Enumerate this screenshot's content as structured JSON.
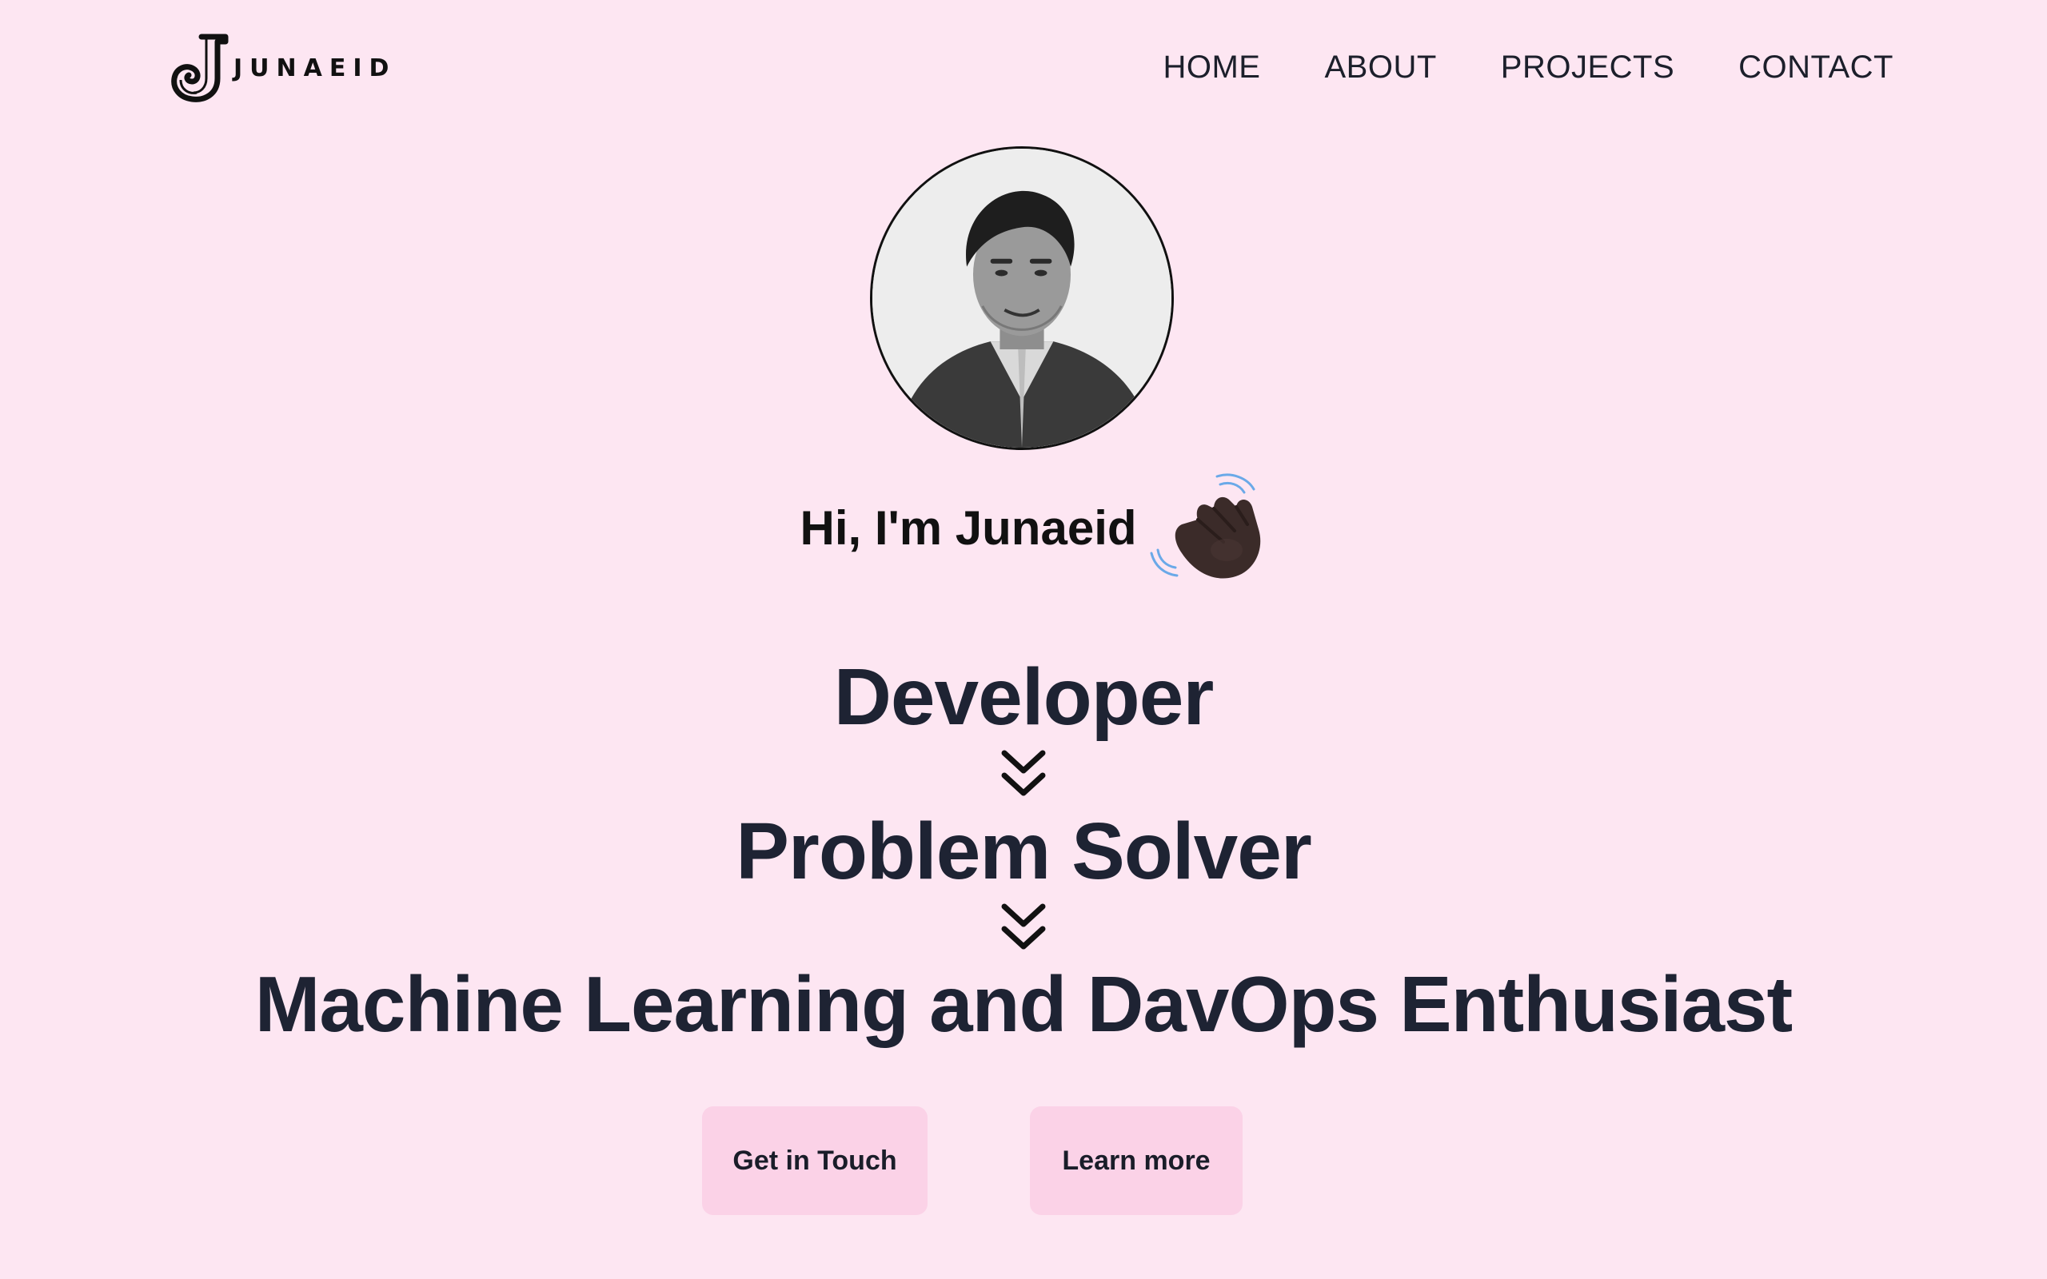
{
  "header": {
    "logo_text": "JUNAEID",
    "logo_icon": "j-monogram-icon",
    "nav": [
      {
        "label": "HOME"
      },
      {
        "label": "ABOUT"
      },
      {
        "label": "PROJECTS"
      },
      {
        "label": "CONTACT"
      }
    ]
  },
  "hero": {
    "avatar_icon": "profile-photo",
    "greeting": "Hi, I'm Junaeid",
    "greeting_icon": "waving-hand-icon",
    "roles": [
      "Developer",
      "Problem Solver",
      "Machine Learning and DavOps Enthusiast"
    ],
    "separator_icon": "double-chevron-down-icon"
  },
  "actions": {
    "primary_label": "Get in Touch",
    "secondary_label": "Learn more"
  },
  "colors": {
    "background": "#fde6f2",
    "button": "#fbd2e7",
    "heading": "#1e2333"
  }
}
